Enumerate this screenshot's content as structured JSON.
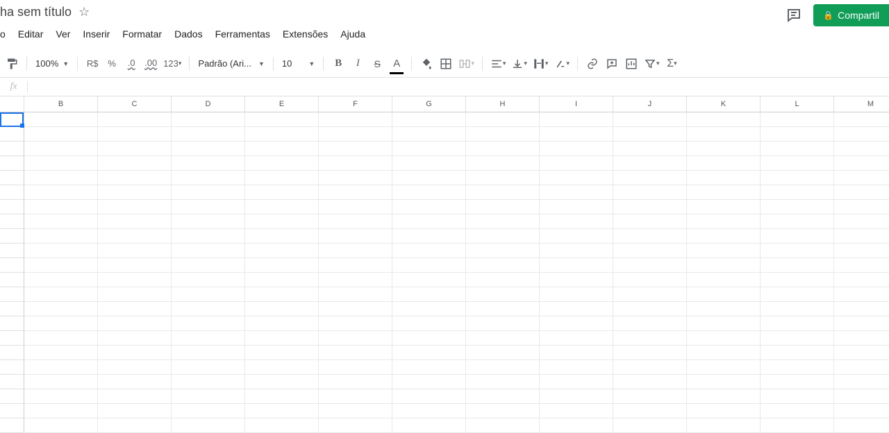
{
  "header": {
    "title": "ha sem título",
    "share_label": "Compartil"
  },
  "menu": {
    "o": "o",
    "editar": "Editar",
    "ver": "Ver",
    "inserir": "Inserir",
    "formatar": "Formatar",
    "dados": "Dados",
    "ferramentas": "Ferramentas",
    "extensoes": "Extensões",
    "ajuda": "Ajuda"
  },
  "toolbar": {
    "zoom": "100%",
    "currency": "R$",
    "percent": "%",
    "dec_dec": ".0",
    "dec_inc": ".00",
    "num_fmt": "123",
    "font": "Padrão (Ari...",
    "size": "10",
    "bold": "B",
    "italic": "I",
    "strike": "S",
    "textcolor": "A"
  },
  "formula": {
    "fx": "fx",
    "value": ""
  },
  "columns": [
    "B",
    "C",
    "D",
    "E",
    "F",
    "G",
    "H",
    "I",
    "J",
    "K",
    "L",
    "M"
  ],
  "selected": {
    "row": 0,
    "col": -1
  }
}
